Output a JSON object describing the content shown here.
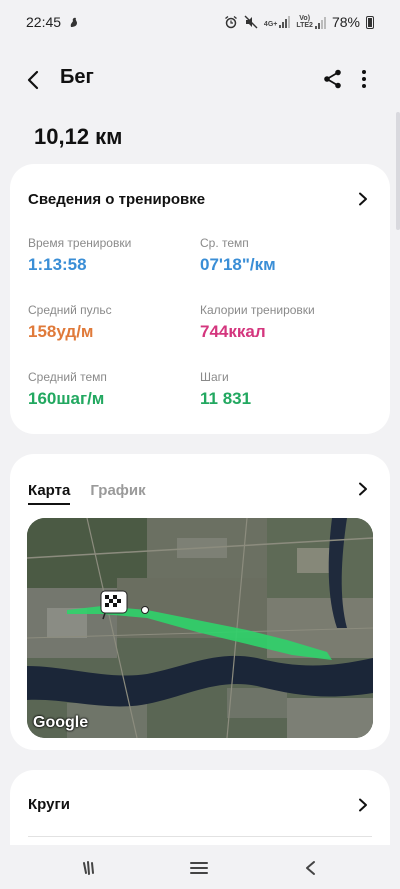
{
  "status_bar": {
    "time": "22:45",
    "battery": "78%",
    "net_top": "4G+",
    "net_volte_1": "Vo)",
    "net_volte_2": "LTE2"
  },
  "header": {
    "title": "Бег"
  },
  "summary": {
    "distance": "10,12 км"
  },
  "details": {
    "title": "Сведения о тренировке",
    "stats": [
      {
        "label": "Время тренировки",
        "value": "1:13:58",
        "unit": "",
        "color": "#3a8ed6"
      },
      {
        "label": "Ср. темп",
        "value": "07'18\"",
        "unit": "/км",
        "color": "#3a8ed6"
      },
      {
        "label": "Средний пульс",
        "value": "158",
        "unit": "уд/м",
        "color": "#e07a3a"
      },
      {
        "label": "Калории тренировки",
        "value": "744",
        "unit": "ккал",
        "color": "#d4367e"
      },
      {
        "label": "Средний темп",
        "value": "160",
        "unit": "шаг/м",
        "color": "#22a860"
      },
      {
        "label": "Шаги",
        "value": "11 831",
        "unit": "",
        "color": "#22a860"
      }
    ]
  },
  "map_card": {
    "tabs": [
      {
        "label": "Карта",
        "active": true
      },
      {
        "label": "График",
        "active": false
      }
    ],
    "map_attribution": "Google"
  },
  "laps": {
    "title": "Круги"
  },
  "icons": {
    "back": "back-arrow-icon",
    "share": "share-icon",
    "more": "more-vertical-icon",
    "chevron": "chevron-right-icon",
    "finish_flag": "finish-flag-icon",
    "nav_recent": "recent-apps-icon",
    "nav_home": "home-icon",
    "nav_back": "nav-back-icon"
  },
  "colors": {
    "blue": "#3a8ed6",
    "orange": "#e07a3a",
    "pink": "#d4367e",
    "green": "#22a860",
    "route": "#2fd36a"
  }
}
